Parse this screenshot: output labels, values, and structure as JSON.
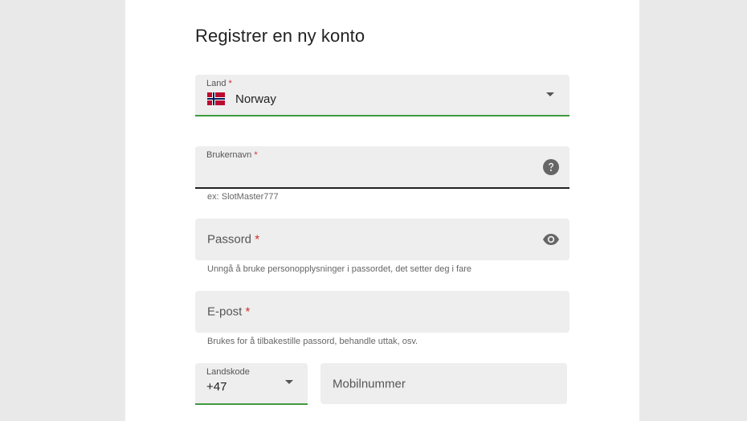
{
  "form": {
    "title": "Registrer en ny konto",
    "required_mark": "*",
    "country": {
      "label": "Land",
      "value": "Norway",
      "flag": "norway-flag"
    },
    "username": {
      "label": "Brukernavn",
      "helper": "ex: SlotMaster777",
      "icon": "help-icon"
    },
    "password": {
      "label": "Passord",
      "helper": "Unngå å bruke personopplysninger i passordet, det setter deg i fare",
      "icon": "eye-icon"
    },
    "email": {
      "label": "E-post",
      "helper": "Brukes for å tilbakestille passord, behandle uttak, osv."
    },
    "country_code": {
      "label": "Landskode",
      "value": "+47"
    },
    "mobile": {
      "label": "Mobilnummer"
    }
  },
  "colors": {
    "accent_green": "#3f9b3f",
    "required_red": "#d42a2a",
    "field_bg": "#eeeeee"
  }
}
